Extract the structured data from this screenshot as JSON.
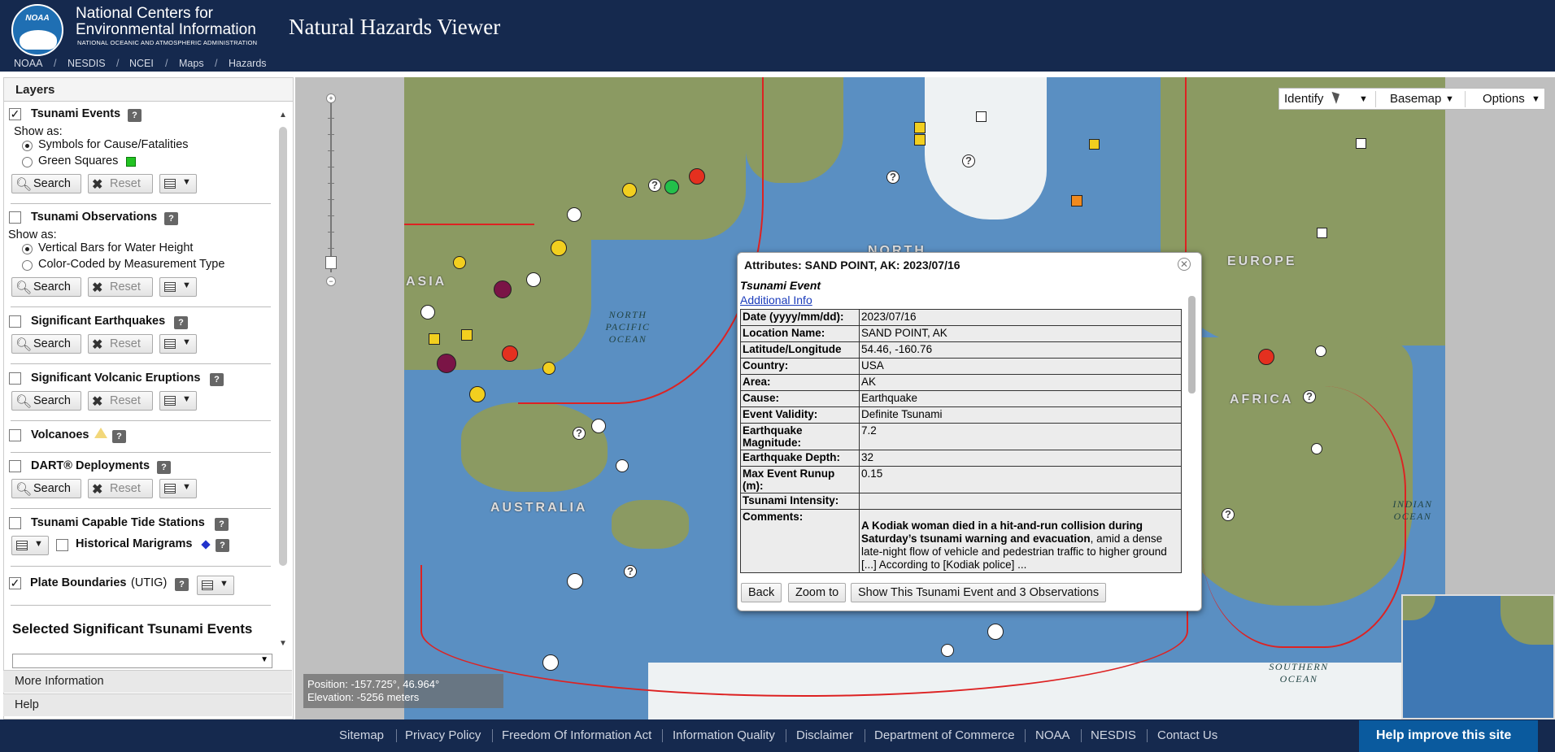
{
  "header": {
    "org_line1": "National Centers for",
    "org_line2": "Environmental Information",
    "org_line3": "NATIONAL OCEANIC AND ATMOSPHERIC ADMINISTRATION",
    "logo_text": "NOAA",
    "app_title": "Natural Hazards Viewer"
  },
  "breadcrumb": [
    "NOAA",
    "NESDIS",
    "NCEI",
    "Maps",
    "Hazards"
  ],
  "breadcrumb_sep": "/",
  "layers": {
    "title": "Layers",
    "show_as": "Show as:",
    "search": "Search",
    "reset": "Reset",
    "help": "?",
    "tsunami_events": "Tsunami Events",
    "te_opt1": "Symbols for Cause/Fatalities",
    "te_opt2": "Green Squares",
    "tsunami_obs": "Tsunami Observations",
    "to_opt1": "Vertical Bars for Water Height",
    "to_opt2": "Color-Coded by Measurement Type",
    "sig_eq": "Significant Earthquakes",
    "sig_volc": "Significant Volcanic Eruptions",
    "volcanoes": "Volcanoes",
    "dart": "DART® Deployments",
    "tide": "Tsunami Capable Tide Stations",
    "marigrams": "Historical Marigrams",
    "plate": "Plate Boundaries",
    "plate_src": "(UTIG)",
    "selected_hdr": "Selected Significant Tsunami Events"
  },
  "accordion": {
    "more_info": "More Information",
    "help": "Help"
  },
  "toolbar": {
    "identify": "Identify",
    "basemap": "Basemap",
    "options": "Options"
  },
  "map_labels": {
    "asia": "ASIA",
    "europe": "EUROPE",
    "africa": "AFRICA",
    "australia": "AUSTRALIA",
    "north": "NORTH",
    "np_ocean": "NORTH\nPACIFIC\nOCEAN",
    "indian_ocean": "INDIAN\nOCEAN",
    "southern_ocean": "SOUTHERN\nOCEAN"
  },
  "position": {
    "coords": "Position: -157.725°, 46.964°",
    "elevation": "Elevation: -5256 meters"
  },
  "popup": {
    "title": "Attributes: SAND POINT, AK: 2023/07/16",
    "subtitle": "Tsunami Event",
    "link": "Additional Info",
    "rows": [
      {
        "k": "Date (yyyy/mm/dd):",
        "v": "2023/07/16"
      },
      {
        "k": "Location Name:",
        "v": "SAND POINT, AK"
      },
      {
        "k": "Latitude/Longitude",
        "v": "54.46, -160.76"
      },
      {
        "k": "Country:",
        "v": "USA"
      },
      {
        "k": "Area:",
        "v": "AK"
      },
      {
        "k": "Cause:",
        "v": "Earthquake"
      },
      {
        "k": "Event Validity:",
        "v": "Definite Tsunami"
      },
      {
        "k": "Earthquake Magnitude:",
        "v": "7.2"
      },
      {
        "k": "Earthquake Depth:",
        "v": "32"
      },
      {
        "k": "Max Event Runup (m):",
        "v": "0.15"
      },
      {
        "k": "Tsunami Intensity:",
        "v": ""
      }
    ],
    "comments_label": "Comments:",
    "comments_bold": "A Kodiak woman died in a hit-and-run collision during Saturday’s tsunami warning and evacuation",
    "comments_rest": ", amid a dense late-night flow of vehicle and pedestrian traffic to higher ground [...] According to [Kodiak police] ...",
    "back": "Back",
    "zoom": "Zoom to",
    "show": "Show This Tsunami Event and 3 Observations"
  },
  "footer": {
    "links": [
      "Sitemap",
      "Privacy Policy",
      "Freedom Of Information Act",
      "Information Quality",
      "Disclaimer",
      "Department of Commerce",
      "NOAA",
      "NESDIS",
      "Contact Us"
    ],
    "help_improve": "Help improve this site"
  },
  "colors": {
    "header_bg": "#15294e",
    "ocean": "#5a8fc2",
    "plate_boundary": "#dd2222",
    "help_improve_bg": "#0a5a9e"
  },
  "icons": [
    "noaa-logo-icon",
    "search-icon",
    "reset-x-icon",
    "legend-menu-icon",
    "help-icon",
    "close-icon",
    "chevron-down-icon",
    "cursor-icon"
  ]
}
